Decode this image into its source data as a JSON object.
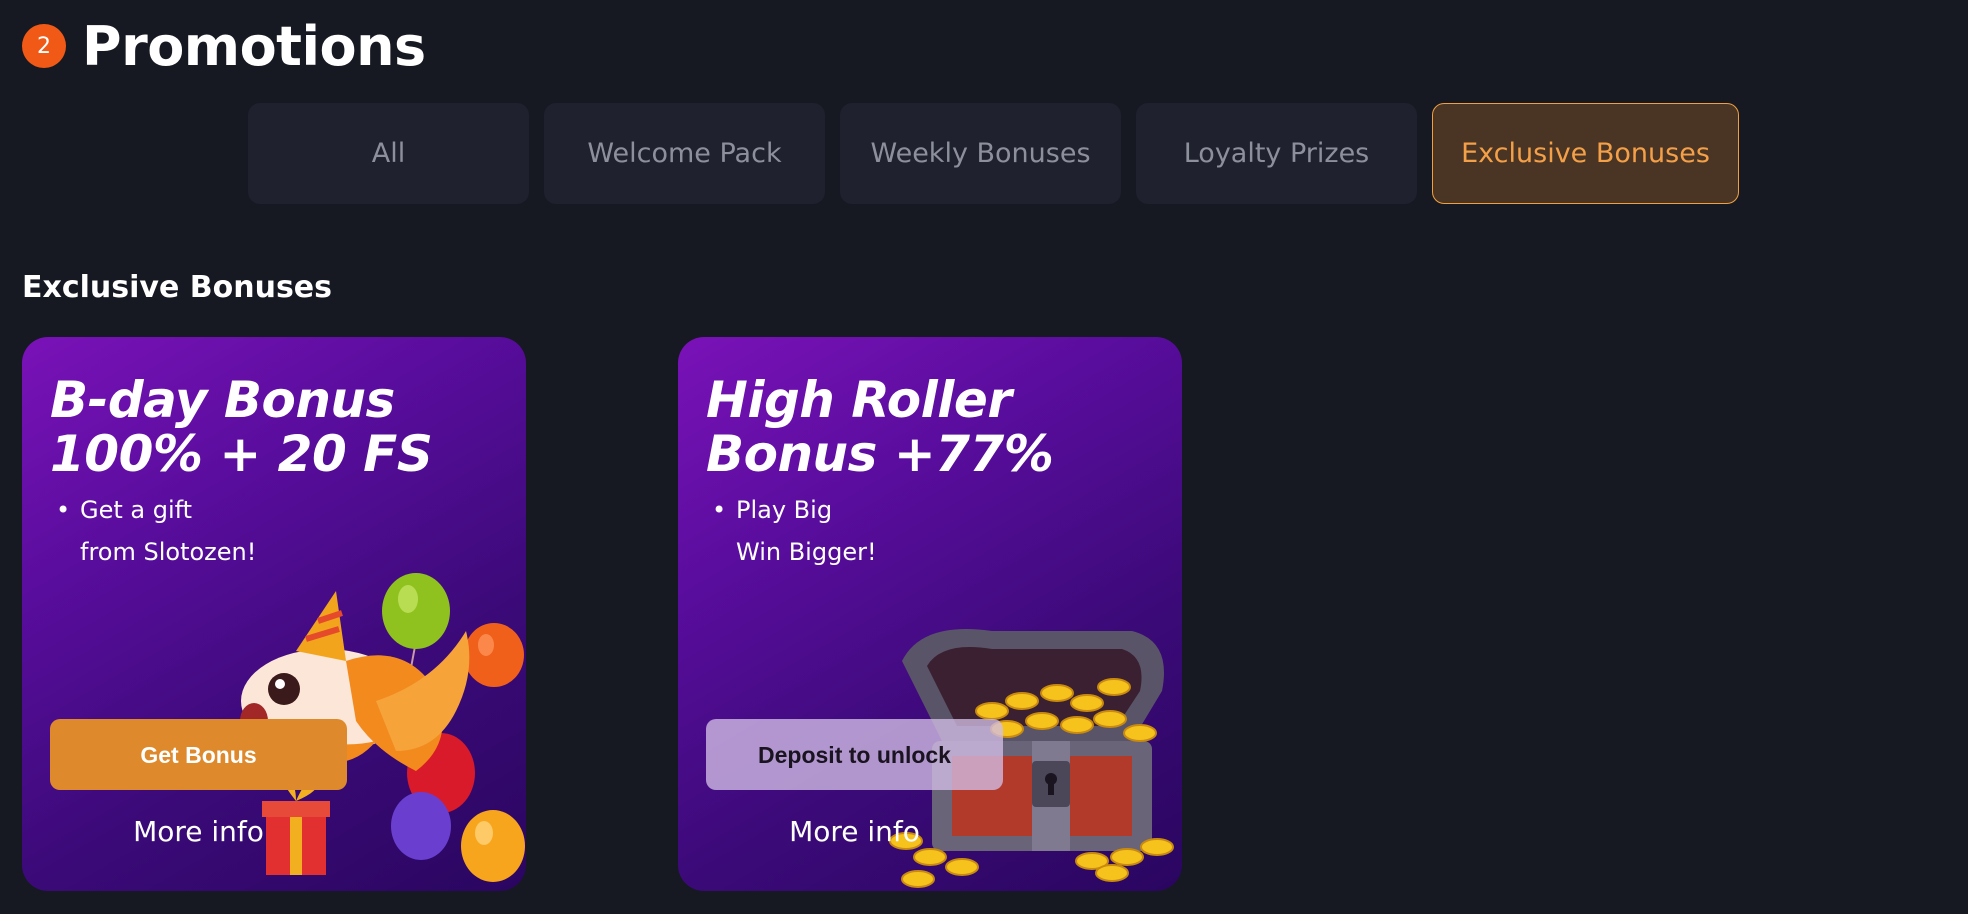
{
  "header": {
    "badge_count": "2",
    "title": "Promotions"
  },
  "tabs": [
    {
      "label": "All",
      "active": false
    },
    {
      "label": "Welcome Pack",
      "active": false
    },
    {
      "label": "Weekly Bonuses",
      "active": false
    },
    {
      "label": "Loyalty Prizes",
      "active": false
    },
    {
      "label": "Exclusive Bonuses",
      "active": true
    }
  ],
  "section": {
    "title": "Exclusive Bonuses"
  },
  "cards": [
    {
      "title_line1": "B-day Bonus",
      "title_line2": "100% + 20 FS",
      "desc_line1": "Get a gift",
      "desc_line2": "from Slotozen!",
      "button_label": "Get Bonus",
      "more_info": "More info",
      "art": "birthday-fish-balloons-gift"
    },
    {
      "title_line1": "High Roller",
      "title_line2": "Bonus +77%",
      "desc_line1": "Play Big",
      "desc_line2": "Win Bigger!",
      "button_label": "Deposit to unlock",
      "more_info": "More info",
      "art": "treasure-chest-coins"
    }
  ],
  "colors": {
    "background": "#161822",
    "tab_bg": "#1f222e",
    "tab_active_bg": "#4a3524",
    "tab_active_text": "#f4a048",
    "badge": "#f15a16",
    "get_bonus_button": "#de8a2c",
    "card_gradient_start": "#7a12b8",
    "card_gradient_end": "#2a0660"
  }
}
